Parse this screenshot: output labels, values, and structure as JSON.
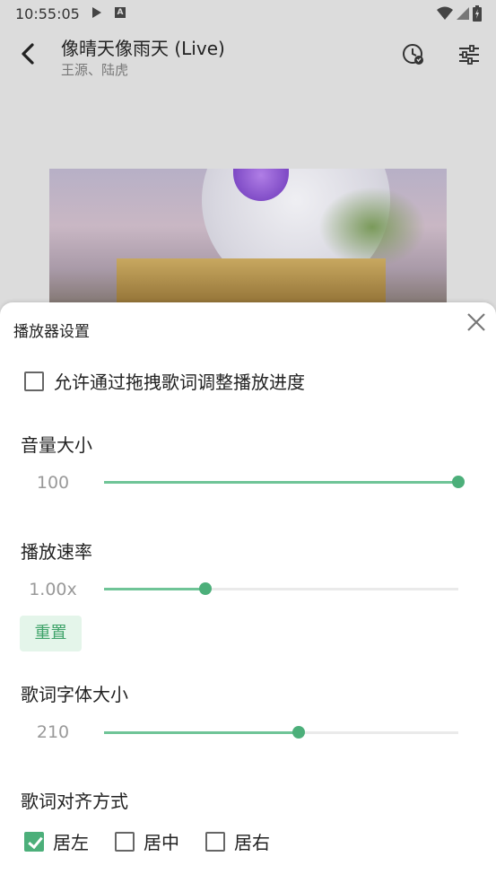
{
  "status_bar": {
    "time": "10:55:05",
    "notification_icons": [
      "play-icon",
      "a-badge-icon"
    ],
    "system_icons": [
      "wifi-icon",
      "signal-icon",
      "battery-icon"
    ],
    "a_badge": "A"
  },
  "header": {
    "title": "像晴天像雨天 (Live)",
    "subtitle": "王源、陆虎",
    "icons": [
      "back-icon",
      "sleep-timer-icon",
      "equalizer-icon"
    ]
  },
  "sheet": {
    "title": "播放器设置",
    "drag_seek_label": "允许通过拖拽歌词调整播放进度",
    "drag_seek_checked": false,
    "volume": {
      "label": "音量大小",
      "value_text": "100",
      "value": 100,
      "max": 100
    },
    "speed": {
      "label": "播放速率",
      "value_text": "1.00x",
      "fraction": 0.285,
      "reset_label": "重置"
    },
    "lyric_font": {
      "label": "歌词字体大小",
      "value_text": "210",
      "fraction": 0.55
    },
    "alignment": {
      "label": "歌词对齐方式",
      "options": [
        {
          "label": "居左",
          "checked": true
        },
        {
          "label": "居中",
          "checked": false
        },
        {
          "label": "居右",
          "checked": false
        }
      ]
    }
  },
  "colors": {
    "accent": "#4caf7a",
    "accent_light": "#6fc497",
    "reset_bg": "#e4f5ea"
  }
}
